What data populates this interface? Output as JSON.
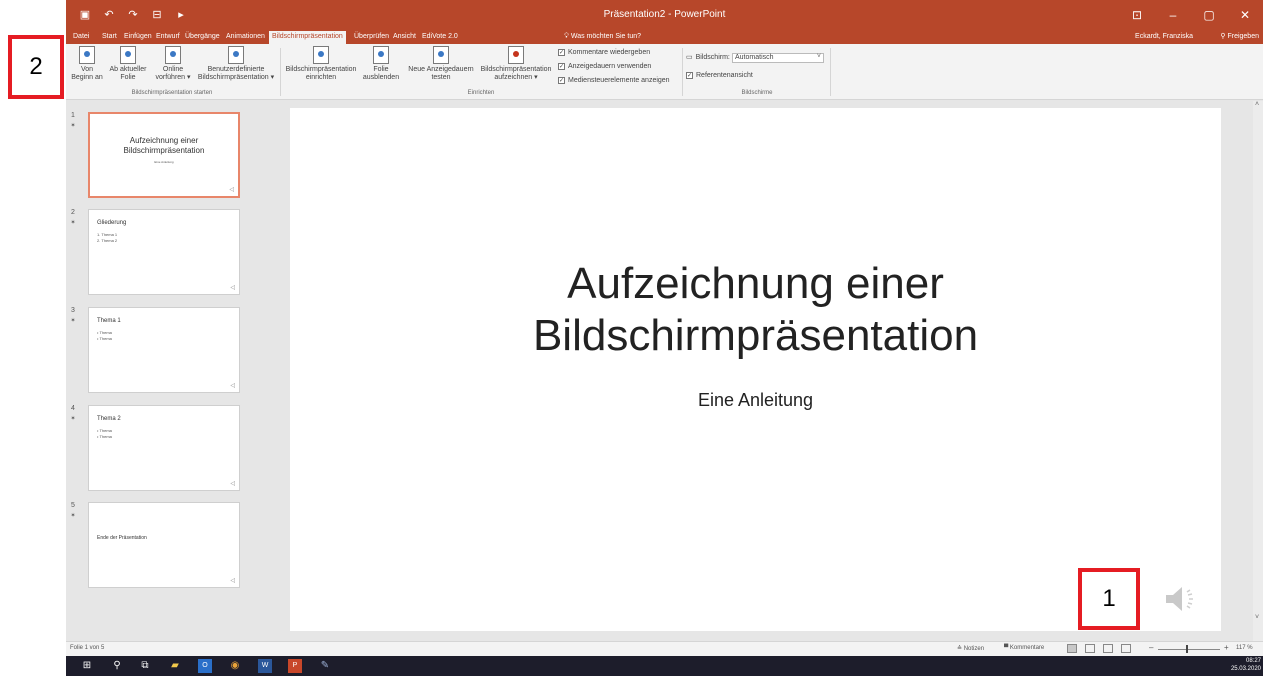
{
  "window": {
    "title": "Präsentation2 - PowerPoint"
  },
  "tabs": [
    {
      "label": "Datei"
    },
    {
      "label": "Start"
    },
    {
      "label": "Einfügen"
    },
    {
      "label": "Entwurf"
    },
    {
      "label": "Übergänge"
    },
    {
      "label": "Animationen"
    },
    {
      "label": "Bildschirmpräsentation"
    },
    {
      "label": "Überprüfen"
    },
    {
      "label": "Ansicht"
    },
    {
      "label": "EdiVote 2.0"
    }
  ],
  "active_tab": "Bildschirmpräsentation",
  "tell_me": "Was möchten Sie tun?",
  "user": "Eckardt, Franziska",
  "share_label": "Freigeben",
  "ribbon": {
    "from_beginning": [
      "Von",
      "Beginn an"
    ],
    "from_current": [
      "Ab aktueller",
      "Folie"
    ],
    "present_online": [
      "Online",
      "vorführen ▾"
    ],
    "custom_show": [
      "Benutzerdefinierte",
      "Bildschirmpräsentation ▾"
    ],
    "group_start": "Bildschirmpräsentation starten",
    "setup_show": [
      "Bildschirmpräsentation",
      "einrichten"
    ],
    "hide_slide": [
      "Folie",
      "ausblenden"
    ],
    "rehearse": [
      "Neue Anzeigedauern",
      "testen"
    ],
    "record": [
      "Bildschirmpräsentation",
      "aufzeichnen ▾"
    ],
    "chk_narrations": "Kommentare wiedergeben",
    "chk_timings": "Anzeigedauern verwenden",
    "chk_media": "Mediensteuerelemente anzeigen",
    "group_setup": "Einrichten",
    "monitor_label": "Bildschirm:",
    "monitor_value": "Automatisch",
    "chk_presenter": "Referentenansicht",
    "group_monitors": "Bildschirme"
  },
  "thumbnails": [
    {
      "num": "1",
      "title": "Aufzeichnung einer Bildschirmpräsentation",
      "sub": "Eine Anleitung",
      "items": []
    },
    {
      "num": "2",
      "title": "Gliederung",
      "sub": "",
      "items": [
        "1.  Thema 1",
        "2.  Thema 2"
      ]
    },
    {
      "num": "3",
      "title": "Thema 1",
      "sub": "",
      "items": [
        "• Thema",
        "• Thema"
      ]
    },
    {
      "num": "4",
      "title": "Thema 2",
      "sub": "",
      "items": [
        "• Thema",
        "• Thema"
      ]
    },
    {
      "num": "5",
      "title": "Ende der Präsentation",
      "sub": "",
      "items": []
    }
  ],
  "slide": {
    "title_line1": "Aufzeichnung einer",
    "title_line2": "Bildschirmpräsentation",
    "subtitle": "Eine Anleitung"
  },
  "status": {
    "slide_count": "Folie 1 von 5",
    "notes": "Notizen",
    "comments": "Kommentare",
    "zoom": "117 %"
  },
  "taskbar": {
    "time": "08:27",
    "date": "25.03.2020"
  },
  "annotations": {
    "box1": "1",
    "box2": "2"
  },
  "colors": {
    "accent": "#b7472a",
    "annotation": "#e51c23",
    "selected_thumb": "#e8866a"
  }
}
